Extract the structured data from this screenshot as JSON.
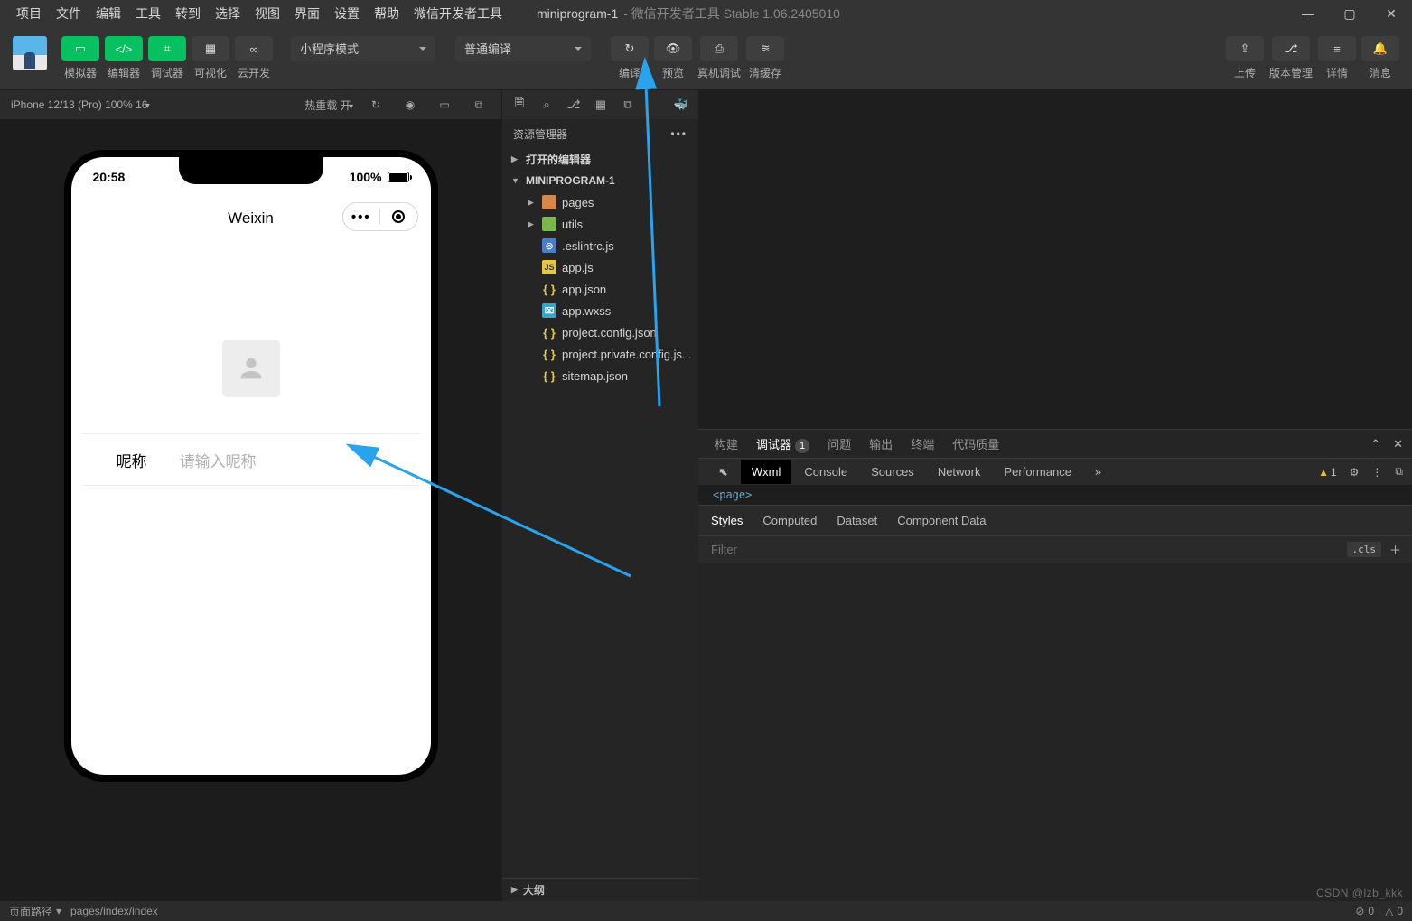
{
  "menubar": {
    "items": [
      "项目",
      "文件",
      "编辑",
      "工具",
      "转到",
      "选择",
      "视图",
      "界面",
      "设置",
      "帮助",
      "微信开发者工具"
    ],
    "title": "miniprogram-1",
    "subtitle": "- 微信开发者工具 Stable 1.06.2405010"
  },
  "toolbar": {
    "left": [
      {
        "icon": "mobile",
        "label": "模拟器",
        "green": true
      },
      {
        "icon": "code",
        "label": "编辑器",
        "green": true
      },
      {
        "icon": "bug",
        "label": "调试器",
        "green": true
      },
      {
        "icon": "layout",
        "label": "可视化",
        "green": false
      },
      {
        "icon": "cloud",
        "label": "云开发",
        "green": false
      }
    ],
    "mode_select": "小程序模式",
    "compile_select": "普通编译",
    "center": [
      {
        "icon": "refresh",
        "label": "编译"
      },
      {
        "icon": "eye",
        "label": "预览"
      },
      {
        "icon": "device",
        "label": "真机调试"
      },
      {
        "icon": "layers",
        "label": "清缓存"
      }
    ],
    "right": [
      {
        "icon": "upload",
        "label": "上传"
      },
      {
        "icon": "branch",
        "label": "版本管理"
      },
      {
        "icon": "list",
        "label": "详情"
      },
      {
        "icon": "bell",
        "label": "消息"
      }
    ]
  },
  "simulator": {
    "device": "iPhone 12/13 (Pro) 100% 16",
    "hot_reload": "热重载 开",
    "icons": [
      "↻",
      "◉",
      "▭",
      "⧉"
    ]
  },
  "phone": {
    "time": "20:58",
    "pct": "100%",
    "mp_title": "Weixin",
    "nickname_label": "昵称",
    "nickname_placeholder": "请输入昵称"
  },
  "explorer": {
    "title": "资源管理器",
    "sections": {
      "open_editors": "打开的编辑器",
      "project": "MINIPROGRAM-1",
      "outline": "大纲"
    },
    "tree": [
      {
        "name": "pages",
        "kind": "folder",
        "icon": "ic-folder"
      },
      {
        "name": "utils",
        "kind": "folder",
        "icon": "ic-folder-g"
      },
      {
        "name": ".eslintrc.js",
        "kind": "file",
        "icon": "ic-blue"
      },
      {
        "name": "app.js",
        "kind": "file",
        "icon": "ic-yellow",
        "txt": "JS"
      },
      {
        "name": "app.json",
        "kind": "file",
        "icon": "ic-brace"
      },
      {
        "name": "app.wxss",
        "kind": "file",
        "icon": "ic-cyan"
      },
      {
        "name": "project.config.json",
        "kind": "file",
        "icon": "ic-brace"
      },
      {
        "name": "project.private.config.js...",
        "kind": "file",
        "icon": "ic-brace"
      },
      {
        "name": "sitemap.json",
        "kind": "file",
        "icon": "ic-brace"
      }
    ]
  },
  "panel": {
    "tabs": [
      "构建",
      "调试器",
      "问题",
      "输出",
      "终端",
      "代码质量"
    ],
    "active": "调试器",
    "badge": "1"
  },
  "devtools": {
    "tabs": [
      "Wxml",
      "Console",
      "Sources",
      "Network",
      "Performance"
    ],
    "active": "Wxml",
    "more": "»",
    "warn_count": "1",
    "page_tag": "<page>"
  },
  "styles": {
    "tabs": [
      "Styles",
      "Computed",
      "Dataset",
      "Component Data"
    ],
    "active": "Styles",
    "filter_placeholder": "Filter",
    "cls_label": ".cls"
  },
  "statusbar": {
    "path_label": "页面路径",
    "path": "pages/index/index",
    "err": "0",
    "warn": "0"
  },
  "watermark": "CSDN @lzb_kkk"
}
